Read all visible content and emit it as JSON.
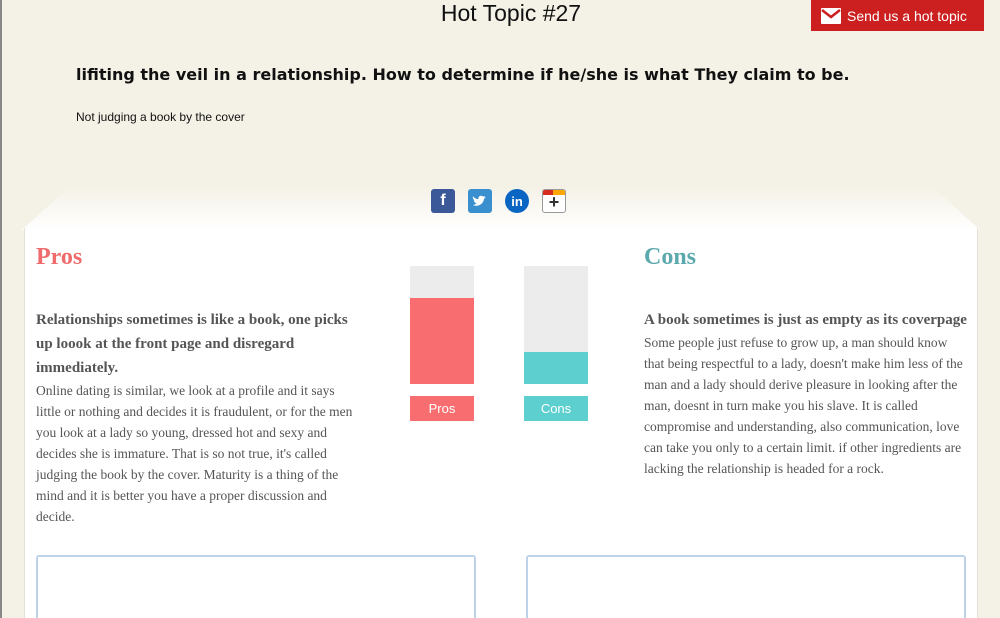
{
  "header": {
    "title": "Hot Topic #27",
    "send_button_label": "Send us a hot topic"
  },
  "topic": {
    "headline": "lifiting the veil in a relationship. How to determine if he/she is what They claim to be.",
    "subheadline": "Not judging a book by the cover"
  },
  "share": {
    "icons": [
      "facebook-icon",
      "twitter-icon",
      "linkedin-icon",
      "google-plus-icon"
    ]
  },
  "pros": {
    "title": "Pros",
    "heading": "Relationships sometimes is like a book, one picks up loook at the front page and disregard immediately.",
    "body": "Online dating is similar, we look at a profile and it says little or nothing and decides it is fraudulent, or for the men you look at a lady so young, dressed hot and sexy and decides she is immature. That is so not true, it's called judging the book by the cover. Maturity is a thing of the mind and it is better you have a proper discussion and decide.",
    "vote_label": "Pros",
    "vote_fraction": 0.73,
    "color": "#f76d70"
  },
  "cons": {
    "title": "Cons",
    "heading": "A book sometimes is just as empty as its coverpage",
    "body": "Some people just refuse to grow up, a man should know that being respectful to a lady, doesn't make him less of the man and a lady should derive pleasure in looking after the man, doesnt in turn make you his slave. It is called compromise and understanding, also communication, love can take you only to a certain limit. if other ingredients are lacking the relationship is headed for a rock.",
    "vote_label": "Cons",
    "vote_fraction": 0.27,
    "color": "#5ecfcf"
  }
}
